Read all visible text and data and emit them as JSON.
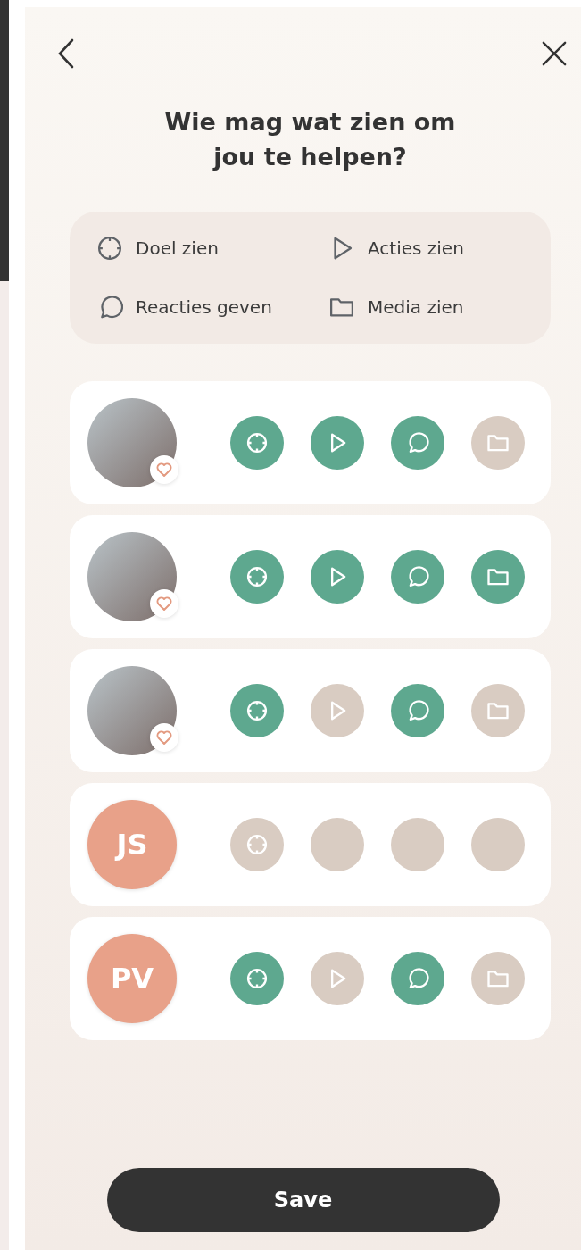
{
  "title": "Wie mag wat zien om jou te helpen?",
  "legend": [
    {
      "kind": "goal",
      "label": "Doel zien"
    },
    {
      "kind": "actions",
      "label": "Acties zien"
    },
    {
      "kind": "comments",
      "label": "Reacties geven"
    },
    {
      "kind": "media",
      "label": "Media zien"
    }
  ],
  "people": [
    {
      "avatar": {
        "kind": "photo"
      },
      "favorite": true,
      "permissions": [
        {
          "kind": "goal",
          "granted": true
        },
        {
          "kind": "actions",
          "granted": true
        },
        {
          "kind": "comments",
          "granted": true
        },
        {
          "kind": "media",
          "granted": false
        }
      ]
    },
    {
      "avatar": {
        "kind": "photo"
      },
      "favorite": true,
      "permissions": [
        {
          "kind": "goal",
          "granted": true
        },
        {
          "kind": "actions",
          "granted": true
        },
        {
          "kind": "comments",
          "granted": true
        },
        {
          "kind": "media",
          "granted": true
        }
      ]
    },
    {
      "avatar": {
        "kind": "photo"
      },
      "favorite": true,
      "permissions": [
        {
          "kind": "goal",
          "granted": true
        },
        {
          "kind": "actions",
          "granted": false
        },
        {
          "kind": "comments",
          "granted": true
        },
        {
          "kind": "media",
          "granted": false
        }
      ]
    },
    {
      "avatar": {
        "kind": "initials",
        "text": "JS"
      },
      "favorite": false,
      "permissions": [
        {
          "kind": "goal",
          "granted": false
        },
        {
          "granted": false
        },
        {
          "granted": false
        },
        {
          "granted": false
        }
      ]
    },
    {
      "avatar": {
        "kind": "initials",
        "text": "PV"
      },
      "favorite": false,
      "permissions": [
        {
          "kind": "goal",
          "granted": true
        },
        {
          "kind": "actions",
          "granted": false
        },
        {
          "kind": "comments",
          "granted": true
        },
        {
          "kind": "media",
          "granted": false
        }
      ]
    }
  ],
  "save_button": "Save"
}
